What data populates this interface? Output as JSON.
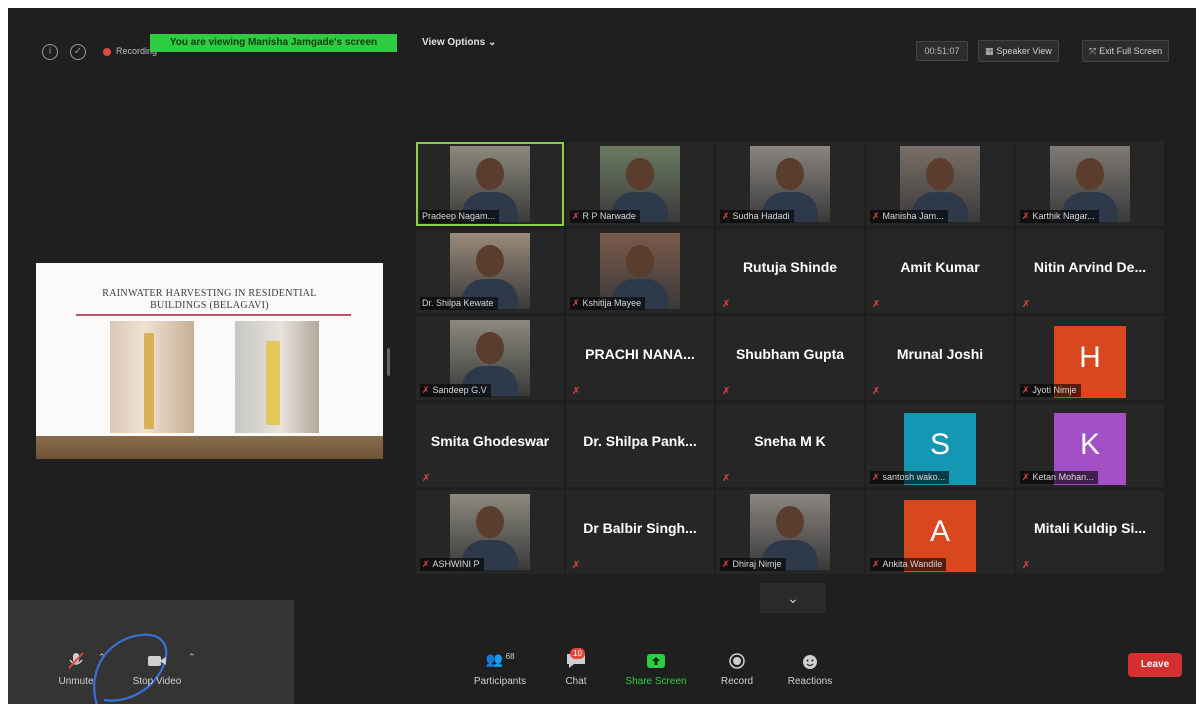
{
  "topbar": {
    "recording_label": "Recording",
    "viewing_banner": "You are viewing Manisha Jamgade's screen",
    "view_options": "View Options ⌄",
    "timer": "00:51:07",
    "speaker_view": "Speaker View",
    "exit_full_screen": "Exit Full Screen"
  },
  "shared_slide": {
    "title_line1": "RAINWATER HARVESTING IN RESIDENTIAL",
    "title_line2": "BUILDINGS (BELAGAVI)"
  },
  "participants_grid": [
    {
      "name": "Pradeep Nagam...",
      "kind": "camera",
      "muted": false,
      "active": true
    },
    {
      "name": "R P Narwade",
      "kind": "camera",
      "muted": true
    },
    {
      "name": "Sudha Hadadi",
      "kind": "camera",
      "muted": true
    },
    {
      "name": "Manisha Jam...",
      "kind": "camera",
      "muted": true
    },
    {
      "name": "Karthik Nagar...",
      "kind": "camera",
      "muted": true
    },
    {
      "name": "Dr. Shilpa Kewate",
      "kind": "camera",
      "muted": false
    },
    {
      "name": "Kshitija Mayee",
      "kind": "camera",
      "muted": true
    },
    {
      "name": "Rutuja Shinde",
      "kind": "name",
      "muted": true
    },
    {
      "name": "Amit Kumar",
      "kind": "name",
      "muted": true
    },
    {
      "name": "Nitin Arvind De...",
      "kind": "name",
      "muted": true
    },
    {
      "name": "Sandeep G.V",
      "kind": "camera",
      "muted": true
    },
    {
      "name": "PRACHI NANA...",
      "kind": "name",
      "muted": true
    },
    {
      "name": "Shubham Gupta",
      "kind": "name",
      "muted": true
    },
    {
      "name": "Mrunal Joshi",
      "kind": "name",
      "muted": true
    },
    {
      "name": "Jyoti Nimje",
      "kind": "avatar",
      "letter": "H",
      "color": "#d9471f",
      "muted": true
    },
    {
      "name": "Smita Ghodeswar",
      "kind": "name",
      "muted": true
    },
    {
      "name": "Dr. Shilpa Pank...",
      "kind": "name",
      "muted": false
    },
    {
      "name": "Sneha M K",
      "kind": "name",
      "muted": true
    },
    {
      "name": "santosh wako...",
      "kind": "avatar",
      "letter": "S",
      "color": "#1597b4",
      "muted": true
    },
    {
      "name": "Ketan Mohan...",
      "kind": "avatar",
      "letter": "K",
      "color": "#a34fc6",
      "muted": true
    },
    {
      "name": "ASHWINI P",
      "kind": "camera",
      "muted": true
    },
    {
      "name": "Dr Balbir Singh...",
      "kind": "name",
      "muted": true
    },
    {
      "name": "Dhiraj Nimje",
      "kind": "camera",
      "muted": true
    },
    {
      "name": "Ankita Wandile",
      "kind": "avatar",
      "letter": "A",
      "color": "#d9471f",
      "muted": true
    },
    {
      "name": "Mitali Kuldip Si...",
      "kind": "name",
      "muted": true
    }
  ],
  "toolbar": {
    "unmute": "Unmute",
    "stop_video": "Stop Video",
    "participants": "Participants",
    "participants_count": "68",
    "chat": "Chat",
    "chat_badge": "10",
    "share_screen": "Share Screen",
    "record": "Record",
    "reactions": "Reactions",
    "leave": "Leave"
  },
  "colors": {
    "background": "#1f1f1f",
    "banner_green": "#2ecc40",
    "share_green": "#2ecc40",
    "leave_red": "#d42f2f",
    "active_speaker": "#8bd24a"
  }
}
